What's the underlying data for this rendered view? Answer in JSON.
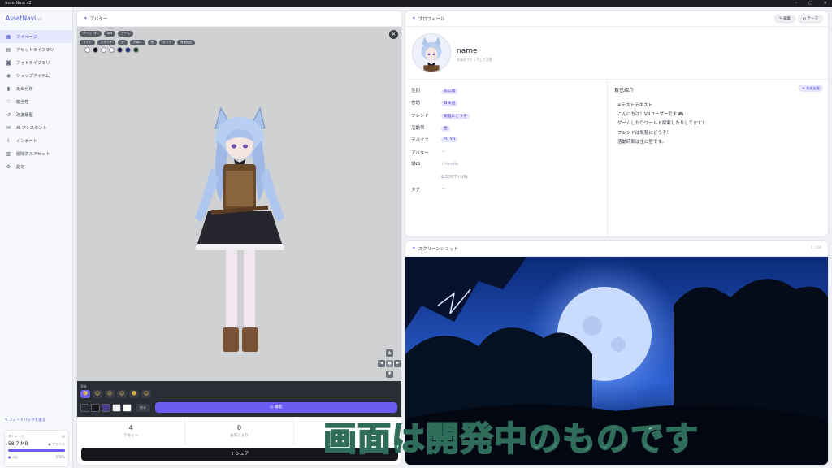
{
  "window": {
    "title": "AssetNavi v2",
    "controls": [
      "–",
      "□",
      "✕"
    ]
  },
  "sidebar": {
    "brand": "AssetNavi",
    "version": "v2",
    "items": [
      {
        "label": "マイページ",
        "icon": "grid-icon",
        "glyph": "▦",
        "active": true
      },
      {
        "label": "アセットライブラリ",
        "icon": "library-icon",
        "glyph": "▤"
      },
      {
        "label": "フォトライブラリ",
        "icon": "camera-icon",
        "glyph": "◙"
      },
      {
        "label": "ショップアイテム",
        "icon": "eye-icon",
        "glyph": "◉"
      },
      {
        "label": "支出分析",
        "icon": "bar-chart-icon",
        "glyph": "▮"
      },
      {
        "label": "健全性",
        "icon": "heart-icon",
        "glyph": "♡"
      },
      {
        "label": "改変履歴",
        "icon": "history-icon",
        "glyph": "↺"
      },
      {
        "label": "AI アシスタント",
        "icon": "chat-icon",
        "glyph": "✉"
      },
      {
        "label": "インポート",
        "icon": "import-icon",
        "glyph": "⇩"
      },
      {
        "label": "削除済みアセット",
        "icon": "trash-icon",
        "glyph": "▥"
      },
      {
        "label": "設定",
        "icon": "gear-icon",
        "glyph": "⚙"
      }
    ],
    "feedback": "フィードバックを送る",
    "storage": {
      "label": "ストレージ",
      "size": "58.7 MB",
      "files_label": "ファイル",
      "legend": ".zip",
      "percent_label": "100%",
      "used_fraction": 1.0
    }
  },
  "avatar_panel": {
    "title": "アバター",
    "chips_row1": [
      "ターン OFF",
      "Idle",
      "ゲーム"
    ],
    "chips_row2": [
      "ライト",
      "スタジオ",
      "夜",
      "夕焼け",
      "雪",
      "カメラ",
      "背景固定"
    ],
    "swatches": [
      "#ffffff",
      "#111111",
      "#ffffff",
      "#f2f2f2",
      "#0e1440",
      "#1c2a6e",
      "#1a3a1a"
    ],
    "toolbar_label": "表情",
    "expressions": [
      "☻",
      "☺",
      "☹",
      "☺",
      "☻",
      "☺"
    ],
    "colors": [
      "#2a2c34",
      "#16161c",
      "#4a3b8c",
      "#f3f3f3",
      "#ffffff"
    ],
    "reset_label": "戻る",
    "capture_label": "撮影",
    "stats": [
      {
        "value": "4",
        "label": "アセット"
      },
      {
        "value": "0",
        "label": "お気に入り"
      }
    ],
    "share_label": "シェア"
  },
  "profile": {
    "title": "プロフィール",
    "edit_label": "編集",
    "theme_label": "テーマ",
    "name": "name",
    "subtitle": "写真をクリックして変更",
    "fields": [
      {
        "label": "性別",
        "value": "非公開",
        "tag": true
      },
      {
        "label": "言語",
        "value": "日本語",
        "tag": true
      },
      {
        "label": "フレンド",
        "value": "気軽にどうぞ",
        "tag": true
      },
      {
        "label": "活動帯",
        "value": "昼",
        "tag": true
      },
      {
        "label": "デバイス",
        "value": "PC VR",
        "tag": true
      },
      {
        "label": "アバター",
        "value": "—",
        "tag": false
      },
      {
        "label": "SNS",
        "value": "handle",
        "tag": false
      },
      {
        "label": "",
        "value": "BOOTH URL",
        "tag": false
      },
      {
        "label": "タグ",
        "value": "—",
        "tag": false
      }
    ],
    "bio_title": "自己紹介",
    "bio_button": "作成支援",
    "bio_lines": [
      "※テストテキスト",
      "こんにちは！VRユーザーです 🎮",
      "ゲームしたりワールド探索したりしてます！",
      "フレンドは気軽にどうぞ！",
      "活動時間は主に昼です。"
    ]
  },
  "screenshots": {
    "title": "スクリーンショット",
    "counter": "1 / 14"
  },
  "overlay_text": "画面は開発中のものです"
}
